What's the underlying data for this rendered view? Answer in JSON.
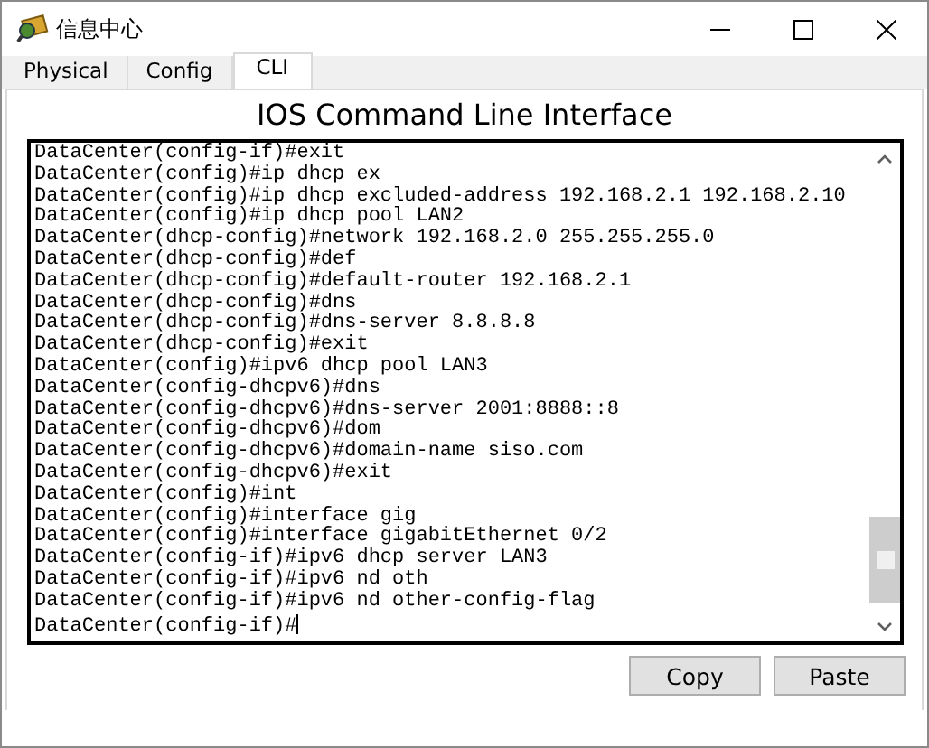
{
  "window": {
    "title": "信息中心"
  },
  "tabs": [
    {
      "label": "Physical",
      "selected": false
    },
    {
      "label": "Config",
      "selected": false
    },
    {
      "label": "CLI",
      "selected": true
    }
  ],
  "heading": "IOS Command Line Interface",
  "terminal": {
    "lines": [
      "DataCenter(config-if)#exit",
      "DataCenter(config)#ip dhcp ex",
      "DataCenter(config)#ip dhcp excluded-address 192.168.2.1 192.168.2.10",
      "DataCenter(config)#ip dhcp pool LAN2",
      "DataCenter(dhcp-config)#network 192.168.2.0 255.255.255.0",
      "DataCenter(dhcp-config)#def",
      "DataCenter(dhcp-config)#default-router 192.168.2.1",
      "DataCenter(dhcp-config)#dns",
      "DataCenter(dhcp-config)#dns-server 8.8.8.8",
      "DataCenter(dhcp-config)#exit",
      "DataCenter(config)#ipv6 dhcp pool LAN3",
      "DataCenter(config-dhcpv6)#dns",
      "DataCenter(config-dhcpv6)#dns-server 2001:8888::8",
      "DataCenter(config-dhcpv6)#dom",
      "DataCenter(config-dhcpv6)#domain-name siso.com",
      "DataCenter(config-dhcpv6)#exit",
      "DataCenter(config)#int",
      "DataCenter(config)#interface gig",
      "DataCenter(config)#interface gigabitEthernet 0/2",
      "DataCenter(config-if)#ipv6 dhcp server LAN3",
      "DataCenter(config-if)#ipv6 nd oth",
      "DataCenter(config-if)#ipv6 nd other-config-flag",
      "DataCenter(config-if)#"
    ]
  },
  "buttons": [
    {
      "label": "Copy"
    },
    {
      "label": "Paste"
    }
  ]
}
